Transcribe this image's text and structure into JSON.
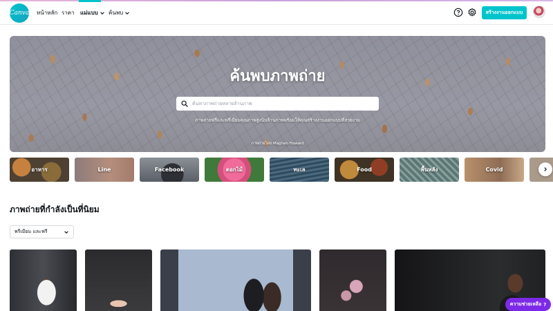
{
  "brand": {
    "logo_text": "Canva",
    "accent": "#00c4cc"
  },
  "nav": {
    "home": "หน้าหลัก",
    "pricing": "ราคา",
    "templates": "แม่แบบ",
    "discover": "ค้นพบ"
  },
  "header": {
    "help_icon": "question-circle-icon",
    "settings_icon": "gear-icon",
    "create_label": "สร้างงานออกแบบ"
  },
  "hero": {
    "title": "ค้นพบภาพถ่าย",
    "search_placeholder": "ค้นหาภาพถ่ายหลายล้านภาพ",
    "subtitle": "ภาพถ่ายฟรีและพรีเมียมคุณภาพสูงนับล้านภาพพร้อมให้คุณสร้างงานออกแบบที่สวยงาม",
    "credit": "ภาพถ่ายโดย Maghan Howard"
  },
  "categories": [
    {
      "label": "อาหาร",
      "color": "#6b5a3a"
    },
    {
      "label": "Line",
      "color": "#9a7a72"
    },
    {
      "label": "Facebook",
      "color": "#5a5f68"
    },
    {
      "label": "ดอกไม้",
      "color": "#d44f7c"
    },
    {
      "label": "ทะเล",
      "color": "#3d5a6e"
    },
    {
      "label": "Food",
      "color": "#6e5632"
    },
    {
      "label": "พื้นหลัง",
      "color": "#607a78"
    },
    {
      "label": "Covid",
      "color": "#a08266"
    }
  ],
  "popular": {
    "title": "ภาพถ่ายที่กำลังเป็นที่นิยม",
    "filter_label": "พรีเมียม และฟรี"
  },
  "help": {
    "label": "ความช่วยเหลือ",
    "mark": "?"
  }
}
